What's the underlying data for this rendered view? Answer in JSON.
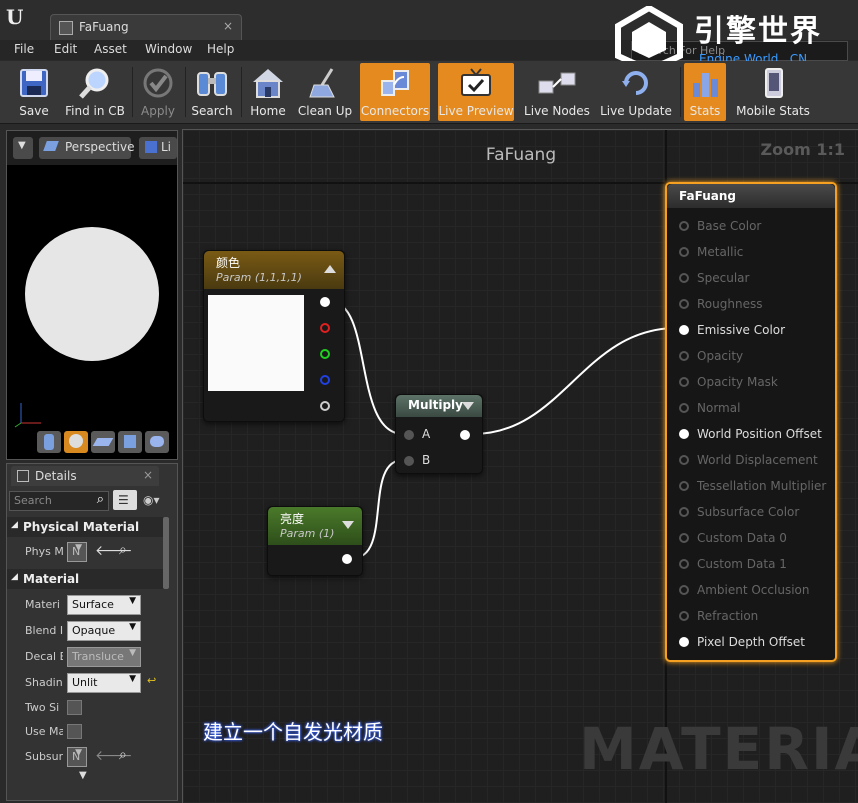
{
  "window": {
    "tab_title": "FaFuang"
  },
  "menu": [
    "File",
    "Edit",
    "Asset",
    "Window",
    "Help"
  ],
  "help_search_placeholder": "Search For Help",
  "watermark": {
    "title": "引擎世界",
    "subtitle": "Engine World . CN"
  },
  "toolbar": [
    {
      "label": "Save",
      "icon": "save-icon",
      "state": "normal"
    },
    {
      "label": "Find in CB",
      "icon": "magnifier-icon",
      "state": "normal"
    },
    {
      "label": "Apply",
      "icon": "checkmark-icon",
      "state": "disabled"
    },
    {
      "label": "Search",
      "icon": "binoculars-icon",
      "state": "normal"
    },
    {
      "label": "Home",
      "icon": "house-icon",
      "state": "normal"
    },
    {
      "label": "Clean Up",
      "icon": "broom-icon",
      "state": "normal"
    },
    {
      "label": "Connectors",
      "icon": "connectors-icon",
      "state": "active"
    },
    {
      "label": "Live Preview",
      "icon": "tv-icon",
      "state": "active"
    },
    {
      "label": "Live Nodes",
      "icon": "live-nodes-icon",
      "state": "normal"
    },
    {
      "label": "Live Update",
      "icon": "refresh-icon",
      "state": "normal"
    },
    {
      "label": "Stats",
      "icon": "bar-chart-icon",
      "state": "active"
    },
    {
      "label": "Mobile Stats",
      "icon": "mobile-icon",
      "state": "normal"
    }
  ],
  "viewport": {
    "view_mode": "Perspective",
    "lit_mode": "Li"
  },
  "details": {
    "tab_label": "Details",
    "search_placeholder": "Search",
    "sections": [
      {
        "title": "Physical Material",
        "props": [
          {
            "label": "Phys M",
            "value": "N"
          }
        ]
      },
      {
        "title": "Material",
        "props": [
          {
            "label": "Materi",
            "value": "Surface"
          },
          {
            "label": "Blend I",
            "value": "Opaque"
          },
          {
            "label": "Decal E",
            "value": "Transluce"
          },
          {
            "label": "Shadin",
            "value": "Unlit"
          },
          {
            "label": "Two Si",
            "value": ""
          },
          {
            "label": "Use Ma",
            "value": ""
          },
          {
            "label": "Subsur",
            "value": "N"
          }
        ]
      }
    ]
  },
  "graph": {
    "title": "FaFuang",
    "zoom": "Zoom 1:1",
    "watermark": "MATERIAL",
    "caption": "建立一个自发光材质",
    "nodes": {
      "color_param": {
        "title": "颜色",
        "subtitle": "Param (1,1,1,1)",
        "header_color": "#7a5a14"
      },
      "multiply": {
        "title": "Multiply",
        "inputs": [
          "A",
          "B"
        ]
      },
      "brightness_param": {
        "title": "亮度",
        "subtitle": "Param (1)",
        "header_color": "#4a7a2a"
      },
      "result": {
        "title": "FaFuang",
        "inputs": [
          {
            "label": "Base Color",
            "active": false
          },
          {
            "label": "Metallic",
            "active": false
          },
          {
            "label": "Specular",
            "active": false
          },
          {
            "label": "Roughness",
            "active": false
          },
          {
            "label": "Emissive Color",
            "active": true
          },
          {
            "label": "Opacity",
            "active": false
          },
          {
            "label": "Opacity Mask",
            "active": false
          },
          {
            "label": "Normal",
            "active": false
          },
          {
            "label": "World Position Offset",
            "active": true
          },
          {
            "label": "World Displacement",
            "active": false
          },
          {
            "label": "Tessellation Multiplier",
            "active": false
          },
          {
            "label": "Subsurface Color",
            "active": false
          },
          {
            "label": "Custom Data 0",
            "active": false
          },
          {
            "label": "Custom Data 1",
            "active": false
          },
          {
            "label": "Ambient Occlusion",
            "active": false
          },
          {
            "label": "Refraction",
            "active": false
          },
          {
            "label": "Pixel Depth Offset",
            "active": true
          }
        ]
      }
    }
  }
}
